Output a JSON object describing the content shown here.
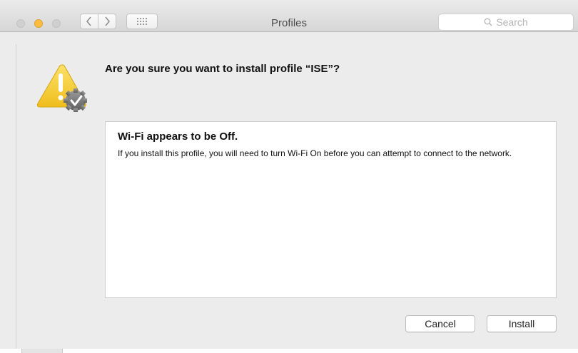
{
  "window": {
    "title": "Profiles"
  },
  "titlebar": {
    "traffic_lights": {
      "close_color": "#d0d0d0",
      "minimize_color": "#fdbc40",
      "zoom_color": "#d0d0d0"
    },
    "nav": {
      "back_icon": "chevron-left-icon",
      "forward_icon": "chevron-right-icon",
      "grid_icon": "show-all-grid-icon"
    },
    "search": {
      "placeholder": "Search",
      "icon": "search-icon"
    }
  },
  "dialog": {
    "icon": "warning-profile-icon",
    "question": "Are you sure you want to install profile “ISE”?",
    "message": {
      "title": "Wi-Fi appears to be Off.",
      "body": "If you install this profile, you will need to turn Wi-Fi On before you can attempt to connect to the network."
    },
    "buttons": {
      "cancel_label": "Cancel",
      "install_label": "Install"
    }
  },
  "colors": {
    "window_background": "#ececec",
    "warning_yellow": "#f6c932"
  }
}
